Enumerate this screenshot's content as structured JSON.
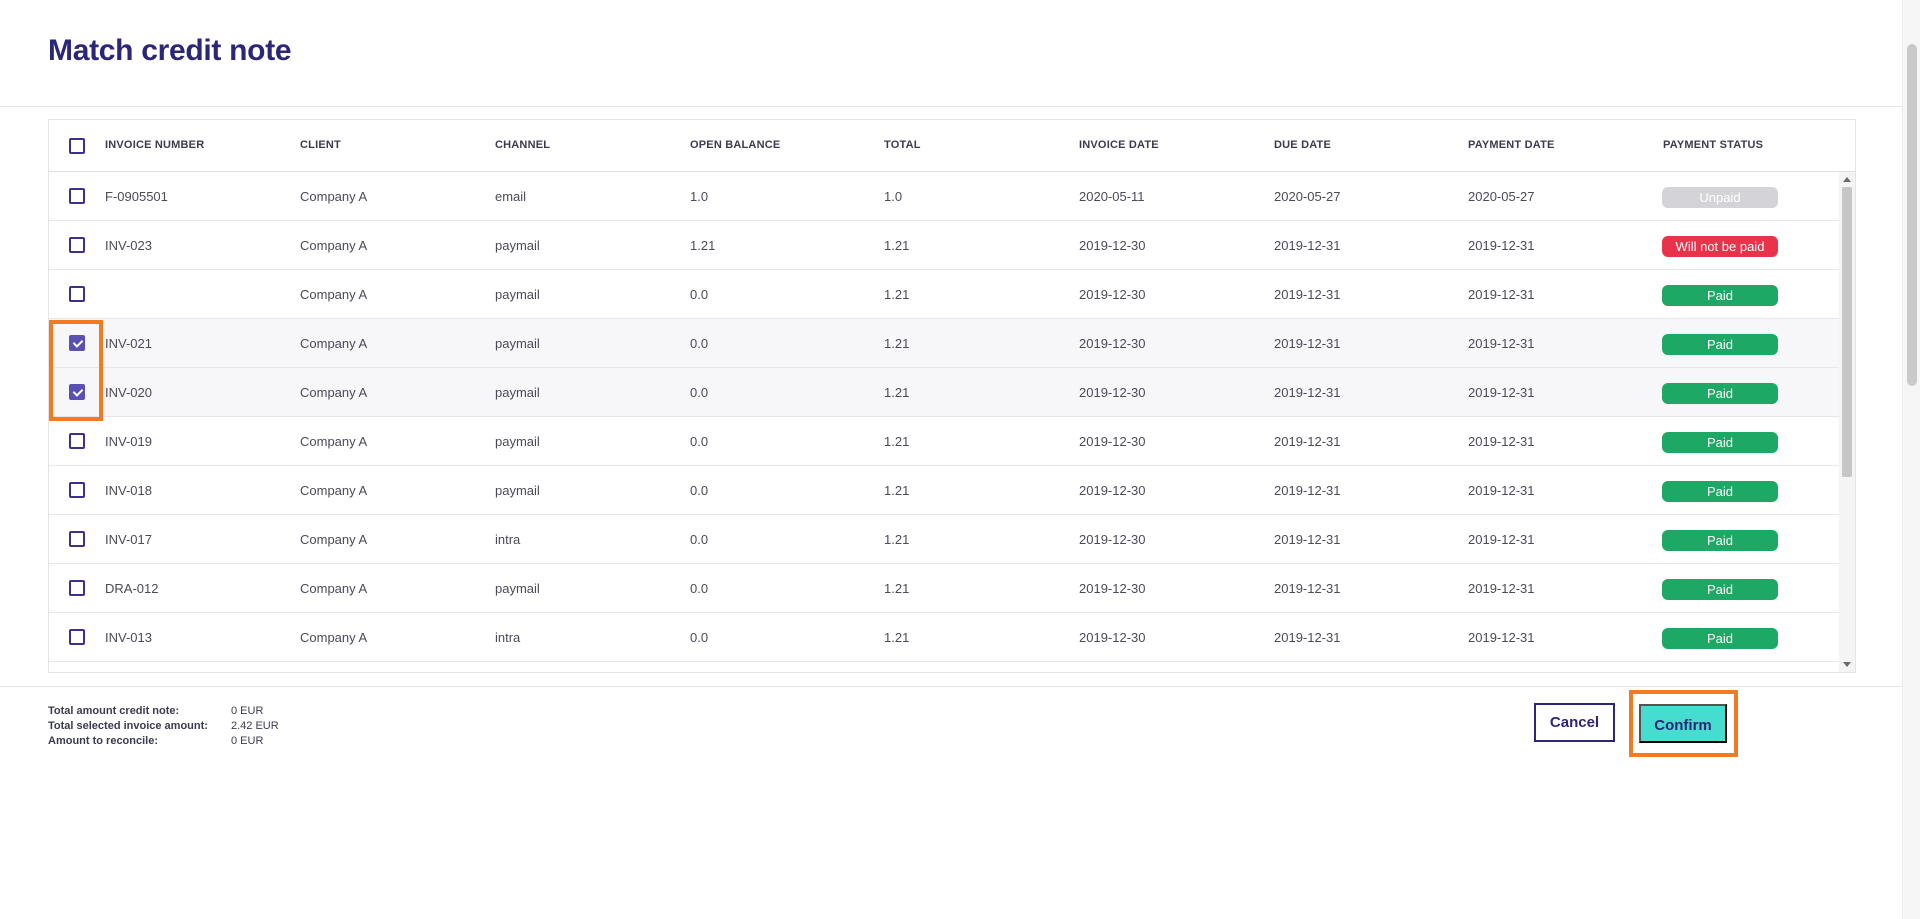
{
  "page": {
    "title": "Match credit note"
  },
  "table": {
    "columns": [
      "INVOICE NUMBER",
      "CLIENT",
      "CHANNEL",
      "OPEN BALANCE",
      "TOTAL",
      "INVOICE DATE",
      "DUE DATE",
      "PAYMENT DATE",
      "PAYMENT STATUS"
    ],
    "rows": [
      {
        "invoice_number": "F-0905501",
        "client": "Company A",
        "channel": "email",
        "open_balance": "1.0",
        "total": "1.0",
        "invoice_date": "2020-05-11",
        "due_date": "2020-05-27",
        "payment_date": "2020-05-27",
        "status": "Unpaid",
        "checked": false
      },
      {
        "invoice_number": "INV-023",
        "client": "Company A",
        "channel": "paymail",
        "open_balance": "1.21",
        "total": "1.21",
        "invoice_date": "2019-12-30",
        "due_date": "2019-12-31",
        "payment_date": "2019-12-31",
        "status": "Will not be paid",
        "checked": false
      },
      {
        "invoice_number": "",
        "client": "Company A",
        "channel": "paymail",
        "open_balance": "0.0",
        "total": "1.21",
        "invoice_date": "2019-12-30",
        "due_date": "2019-12-31",
        "payment_date": "2019-12-31",
        "status": "Paid",
        "checked": false
      },
      {
        "invoice_number": "INV-021",
        "client": "Company A",
        "channel": "paymail",
        "open_balance": "0.0",
        "total": "1.21",
        "invoice_date": "2019-12-30",
        "due_date": "2019-12-31",
        "payment_date": "2019-12-31",
        "status": "Paid",
        "checked": true
      },
      {
        "invoice_number": "INV-020",
        "client": "Company A",
        "channel": "paymail",
        "open_balance": "0.0",
        "total": "1.21",
        "invoice_date": "2019-12-30",
        "due_date": "2019-12-31",
        "payment_date": "2019-12-31",
        "status": "Paid",
        "checked": true
      },
      {
        "invoice_number": "INV-019",
        "client": "Company A",
        "channel": "paymail",
        "open_balance": "0.0",
        "total": "1.21",
        "invoice_date": "2019-12-30",
        "due_date": "2019-12-31",
        "payment_date": "2019-12-31",
        "status": "Paid",
        "checked": false
      },
      {
        "invoice_number": "INV-018",
        "client": "Company A",
        "channel": "paymail",
        "open_balance": "0.0",
        "total": "1.21",
        "invoice_date": "2019-12-30",
        "due_date": "2019-12-31",
        "payment_date": "2019-12-31",
        "status": "Paid",
        "checked": false
      },
      {
        "invoice_number": "INV-017",
        "client": "Company A",
        "channel": "intra",
        "open_balance": "0.0",
        "total": "1.21",
        "invoice_date": "2019-12-30",
        "due_date": "2019-12-31",
        "payment_date": "2019-12-31",
        "status": "Paid",
        "checked": false
      },
      {
        "invoice_number": "DRA-012",
        "client": "Company A",
        "channel": "paymail",
        "open_balance": "0.0",
        "total": "1.21",
        "invoice_date": "2019-12-30",
        "due_date": "2019-12-31",
        "payment_date": "2019-12-31",
        "status": "Paid",
        "checked": false
      },
      {
        "invoice_number": "INV-013",
        "client": "Company A",
        "channel": "intra",
        "open_balance": "0.0",
        "total": "1.21",
        "invoice_date": "2019-12-30",
        "due_date": "2019-12-31",
        "payment_date": "2019-12-31",
        "status": "Paid",
        "checked": false
      }
    ]
  },
  "summary": [
    {
      "label": "Total amount credit note:",
      "value": "0 EUR"
    },
    {
      "label": "Total selected invoice amount:",
      "value": "2.42 EUR"
    },
    {
      "label": "Amount to reconcile:",
      "value": "0 EUR"
    }
  ],
  "actions": {
    "cancel_label": "Cancel",
    "confirm_label": "Confirm"
  },
  "colors": {
    "title": "#2b2675",
    "checkbox": "#3b3290",
    "checkbox_checked": "#5a4fb4",
    "status_paid": "#1ea866",
    "status_not_paid": "#e8334b",
    "status_unpaid": "#d4d4d8",
    "confirm_bg": "#45ddd0",
    "highlight": "#f27a21"
  }
}
